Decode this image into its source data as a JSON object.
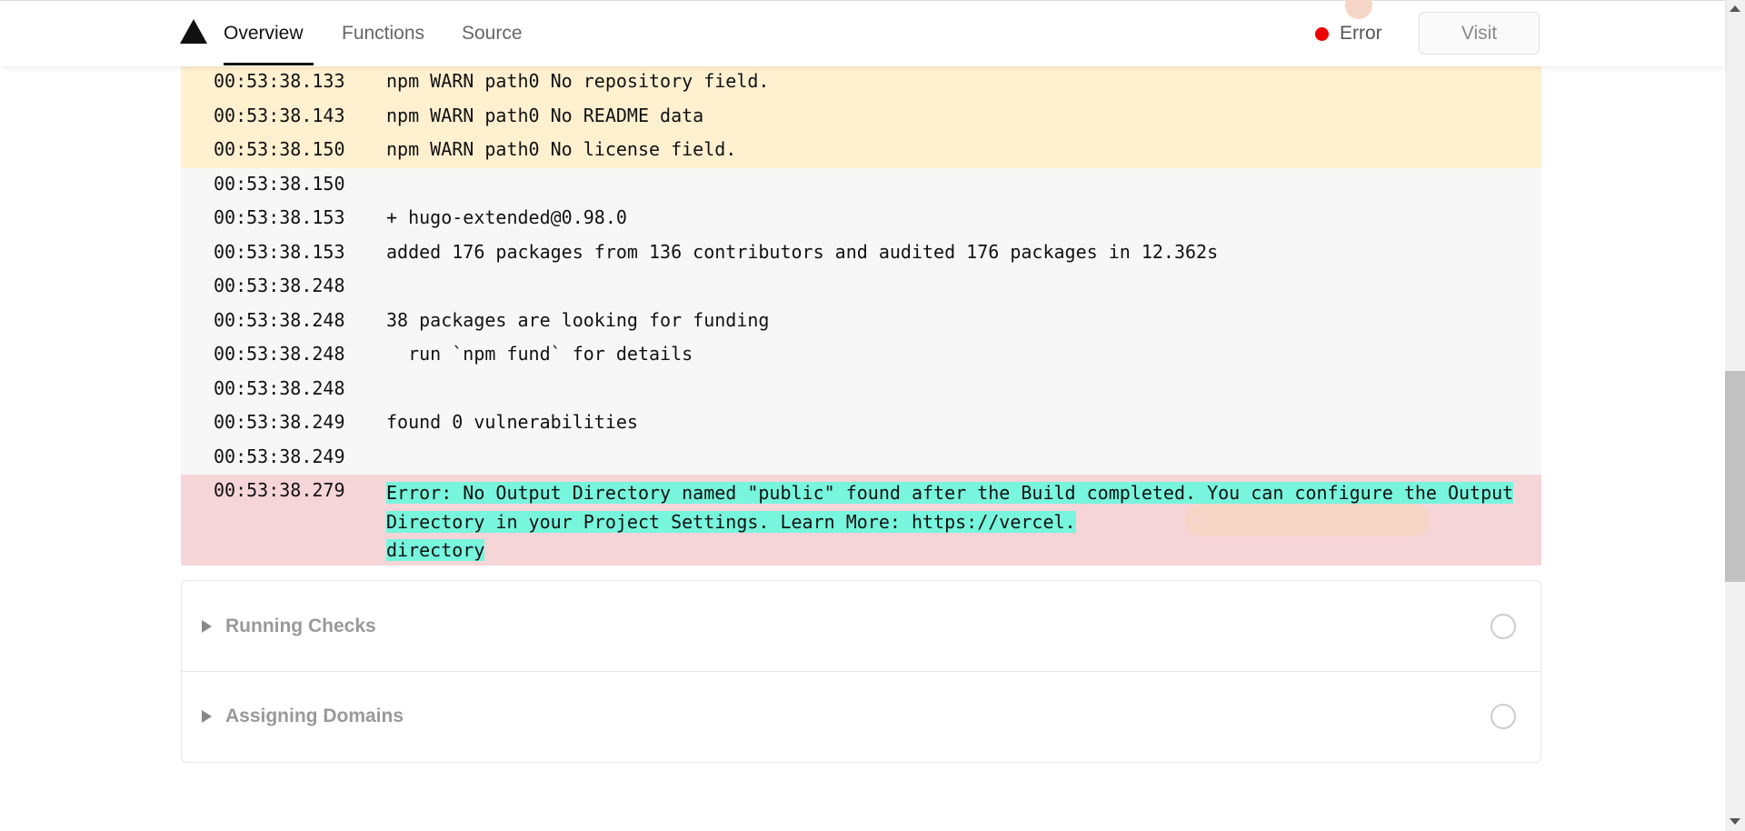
{
  "header": {
    "logo_icon": "vercel-triangle-icon",
    "tabs": [
      {
        "label": "Overview",
        "active": true
      },
      {
        "label": "Functions",
        "active": false
      },
      {
        "label": "Source",
        "active": false
      }
    ],
    "status": {
      "label": "Error",
      "color": "#ee0000"
    },
    "visit_label": "Visit"
  },
  "log": {
    "warn_rows": [
      {
        "time": "00:53:38.133",
        "message": "npm WARN path0 No repository field."
      },
      {
        "time": "00:53:38.143",
        "message": "npm WARN path0 No README data"
      },
      {
        "time": "00:53:38.150",
        "message": "npm WARN path0 No license field."
      }
    ],
    "rows": [
      {
        "time": "00:53:38.150",
        "message": ""
      },
      {
        "time": "00:53:38.153",
        "message": "+ hugo-extended@0.98.0"
      },
      {
        "time": "00:53:38.153",
        "message": "added 176 packages from 136 contributors and audited 176 packages in 12.362s"
      },
      {
        "time": "00:53:38.248",
        "message": ""
      },
      {
        "time": "00:53:38.248",
        "message": "38 packages are looking for funding"
      },
      {
        "time": "00:53:38.248",
        "message": "  run `npm fund` for details"
      },
      {
        "time": "00:53:38.248",
        "message": ""
      },
      {
        "time": "00:53:38.249",
        "message": "found 0 vulnerabilities"
      },
      {
        "time": "00:53:38.249",
        "message": ""
      }
    ],
    "error_row": {
      "time": "00:53:38.279",
      "message": "Error: No Output Directory named \"public\" found after the Build completed. You can configure the Output Directory in your Project Settings. Learn More: https://vercel.",
      "message_tail": "directory"
    }
  },
  "steps": [
    {
      "label": "Running Checks"
    },
    {
      "label": "Assigning Domains"
    }
  ],
  "colors": {
    "warn_bg": "#fff0d0",
    "plain_bg": "#f7f7f7",
    "error_bg": "#f6d5d8",
    "highlight": "#77f5dd",
    "status_error": "#ee0000"
  }
}
